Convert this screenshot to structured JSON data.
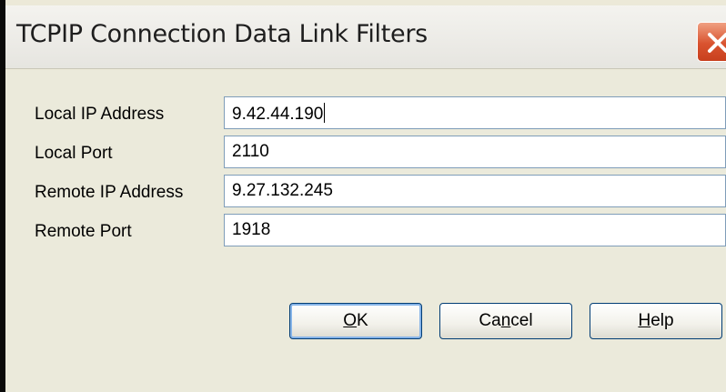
{
  "dialog": {
    "title": "TCPIP Connection Data Link Filters"
  },
  "fields": [
    {
      "label": "Local IP Address",
      "value": "9.42.44.190"
    },
    {
      "label": "Local Port",
      "value": "2110"
    },
    {
      "label": "Remote IP Address",
      "value": "9.27.132.245"
    },
    {
      "label": "Remote Port",
      "value": "1918"
    }
  ],
  "buttons": {
    "ok": {
      "label": "OK",
      "mnemonic": "O"
    },
    "cancel": {
      "label": "Cancel",
      "mnemonic": "n"
    },
    "help": {
      "label": "Help",
      "mnemonic": "H"
    }
  },
  "icons": {
    "close": "close-icon"
  },
  "colors": {
    "close_button": "#d9532f",
    "dialog_background": "#ebeadb",
    "input_border": "#7f9db9",
    "button_border": "#003c74"
  }
}
